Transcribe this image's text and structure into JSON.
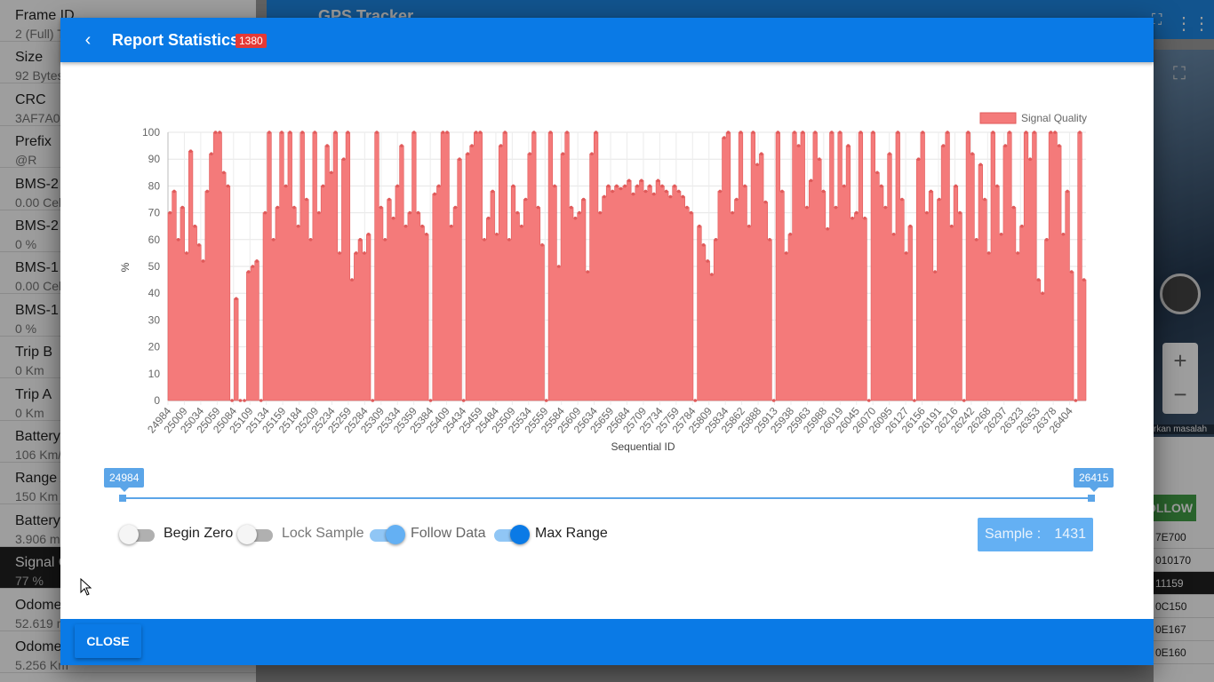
{
  "background": {
    "app_title": "GPS Tracker",
    "sidebar_items": [
      {
        "label": "Frame ID",
        "value": "2 (Full) T"
      },
      {
        "label": "Size",
        "value": "92 Bytes"
      },
      {
        "label": "CRC",
        "value": "3AF7A0"
      },
      {
        "label": "Prefix",
        "value": "@R"
      },
      {
        "label": "BMS-2",
        "value": "0.00 Cel"
      },
      {
        "label": "BMS-2",
        "value": "0 %"
      },
      {
        "label": "BMS-1",
        "value": "0.00 Cel"
      },
      {
        "label": "BMS-1",
        "value": "0 %"
      },
      {
        "label": "Trip B",
        "value": "0 Km"
      },
      {
        "label": "Trip A",
        "value": "0 Km"
      },
      {
        "label": "Battery",
        "value": "106 Km/"
      },
      {
        "label": "Range A",
        "value": "150 Km"
      },
      {
        "label": "Battery",
        "value": "3.906 m"
      },
      {
        "label": "Signal Q",
        "value": "77 %"
      },
      {
        "label": "Odome",
        "value": "52.619 m"
      },
      {
        "label": "Odome",
        "value": "5.256 Km"
      }
    ],
    "follow_label": "OLLOW",
    "map_caption": "rkan masalah",
    "hex_list": [
      "7E700",
      "010170",
      "11159",
      "0C150",
      "0E167",
      "0E160"
    ]
  },
  "dialog": {
    "title": "Report Statistics",
    "badge": "1380",
    "close_label": "CLOSE",
    "range": {
      "min": "24984",
      "max": "26415"
    },
    "toggles": [
      {
        "label": "Begin Zero",
        "on": false
      },
      {
        "label": "Lock Sample",
        "on": false
      },
      {
        "label": "Follow Data",
        "on": true
      },
      {
        "label": "Max Range",
        "on": true
      }
    ],
    "sample": {
      "label": "Sample :",
      "value": "1431"
    }
  },
  "colors": {
    "primary": "#0a7ae6",
    "series_fill": "#f47a7a",
    "series_line": "#e05a5a",
    "badge": "#e53935",
    "accent": "#5ba5e8"
  },
  "chart_data": {
    "type": "area",
    "xlabel": "Sequential ID",
    "ylabel": "%",
    "ylim": [
      0,
      100
    ],
    "yticks": [
      0,
      10,
      20,
      30,
      40,
      50,
      60,
      70,
      80,
      90,
      100
    ],
    "grid": true,
    "legend_position": "top-right",
    "x_tick_labels": [
      "24984",
      "25009",
      "25034",
      "25059",
      "25084",
      "25109",
      "25134",
      "25159",
      "25184",
      "25209",
      "25234",
      "25259",
      "25284",
      "25309",
      "25334",
      "25359",
      "25384",
      "25409",
      "25434",
      "25459",
      "25484",
      "25509",
      "25534",
      "25559",
      "25584",
      "25609",
      "25634",
      "25659",
      "25684",
      "25709",
      "25734",
      "25759",
      "25784",
      "25809",
      "25834",
      "25862",
      "25888",
      "25913",
      "25938",
      "25963",
      "25988",
      "26019",
      "26045",
      "26070",
      "26095",
      "26127",
      "26156",
      "26191",
      "26216",
      "26242",
      "26268",
      "26297",
      "26323",
      "26353",
      "26378",
      "26404"
    ],
    "series": [
      {
        "name": "Signal Quality",
        "values": [
          70,
          78,
          60,
          72,
          55,
          93,
          65,
          58,
          52,
          78,
          92,
          100,
          100,
          85,
          80,
          0,
          38,
          0,
          0,
          48,
          50,
          52,
          0,
          70,
          100,
          60,
          72,
          100,
          80,
          100,
          72,
          65,
          100,
          75,
          60,
          100,
          70,
          80,
          95,
          85,
          100,
          55,
          90,
          100,
          45,
          55,
          60,
          55,
          62,
          0,
          100,
          72,
          60,
          75,
          68,
          80,
          95,
          65,
          70,
          100,
          70,
          65,
          62,
          0,
          77,
          80,
          100,
          100,
          65,
          72,
          90,
          0,
          92,
          95,
          100,
          100,
          60,
          68,
          78,
          62,
          95,
          100,
          60,
          80,
          70,
          65,
          75,
          92,
          100,
          72,
          58,
          0,
          100,
          80,
          50,
          92,
          100,
          72,
          68,
          70,
          75,
          48,
          92,
          100,
          70,
          76,
          80,
          78,
          80,
          79,
          80,
          82,
          77,
          80,
          82,
          78,
          80,
          77,
          82,
          80,
          78,
          76,
          80,
          78,
          76,
          72,
          70,
          0,
          65,
          58,
          52,
          47,
          60,
          78,
          98,
          100,
          70,
          75,
          100,
          80,
          65,
          100,
          88,
          92,
          74,
          60,
          0,
          100,
          78,
          55,
          62,
          100,
          95,
          100,
          72,
          82,
          100,
          90,
          78,
          64,
          100,
          72,
          100,
          80,
          95,
          68,
          70,
          100,
          68,
          0,
          100,
          85,
          80,
          72,
          92,
          62,
          100,
          75,
          55,
          65,
          0,
          90,
          100,
          70,
          78,
          48,
          75,
          95,
          100,
          65,
          80,
          70,
          0,
          100,
          92,
          60,
          88,
          75,
          55,
          100,
          80,
          62,
          95,
          100,
          72,
          55,
          65,
          100,
          90,
          100,
          45,
          40,
          60,
          100,
          100,
          95,
          62,
          78,
          48,
          0,
          100,
          45
        ]
      }
    ]
  }
}
